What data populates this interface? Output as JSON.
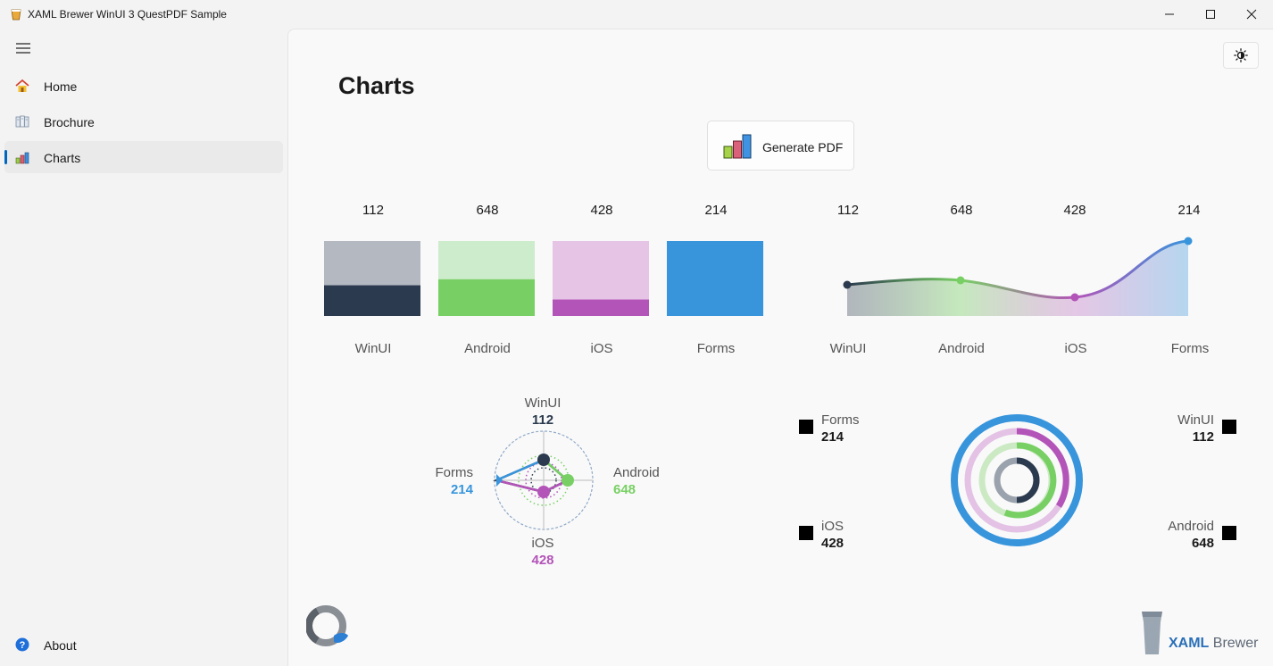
{
  "window": {
    "title": "XAML Brewer WinUI 3 QuestPDF Sample",
    "icon": "beer-glass-icon",
    "controls": [
      "minimize-icon",
      "maximize-icon",
      "close-icon"
    ]
  },
  "sidebar": {
    "menu_icon": "hamburger-icon",
    "items": [
      {
        "label": "Home",
        "icon": "house-icon",
        "selected": false
      },
      {
        "label": "Brochure",
        "icon": "brochure-icon",
        "selected": false
      },
      {
        "label": "Charts",
        "icon": "bar-chart-icon",
        "selected": true
      }
    ],
    "footer": {
      "label": "About",
      "icon": "help-icon"
    }
  },
  "page": {
    "title": "Charts",
    "theme_toggle_icon": "sun-icon",
    "generate_button": {
      "label": "Generate PDF",
      "icon": "bar-chart-icon"
    }
  },
  "colors": {
    "winui": "#2b3a4e",
    "android": "#78d064",
    "ios": "#b354b8",
    "forms": "#3895dc"
  },
  "chart_data": [
    {
      "type": "bar",
      "categories": [
        "WinUI",
        "Android",
        "iOS",
        "Forms"
      ],
      "values": [
        112,
        648,
        428,
        214
      ],
      "value_labels": [
        "112",
        "648",
        "428",
        "214"
      ],
      "fill_fraction": [
        0.41,
        0.49,
        0.22,
        1.0
      ]
    },
    {
      "type": "area",
      "categories": [
        "WinUI",
        "Android",
        "iOS",
        "Forms"
      ],
      "values": [
        112,
        648,
        428,
        214
      ],
      "value_labels": [
        "112",
        "648",
        "428",
        "214"
      ]
    },
    {
      "type": "radar",
      "categories": [
        "WinUI",
        "Android",
        "iOS",
        "Forms"
      ],
      "values": [
        112,
        648,
        428,
        214
      ],
      "value_labels": [
        "112",
        "648",
        "428",
        "214"
      ]
    },
    {
      "type": "radial-bar",
      "categories": [
        "Forms",
        "iOS",
        "WinUI",
        "Android"
      ],
      "values": [
        214,
        428,
        112,
        648
      ],
      "value_labels": [
        "214",
        "428",
        "112",
        "648"
      ]
    }
  ],
  "footer": {
    "left_logo": "questpdf-logo",
    "right_logo": "xaml-brewer-logo",
    "brand_part1": "XAML",
    "brand_part2": " Brewer"
  }
}
